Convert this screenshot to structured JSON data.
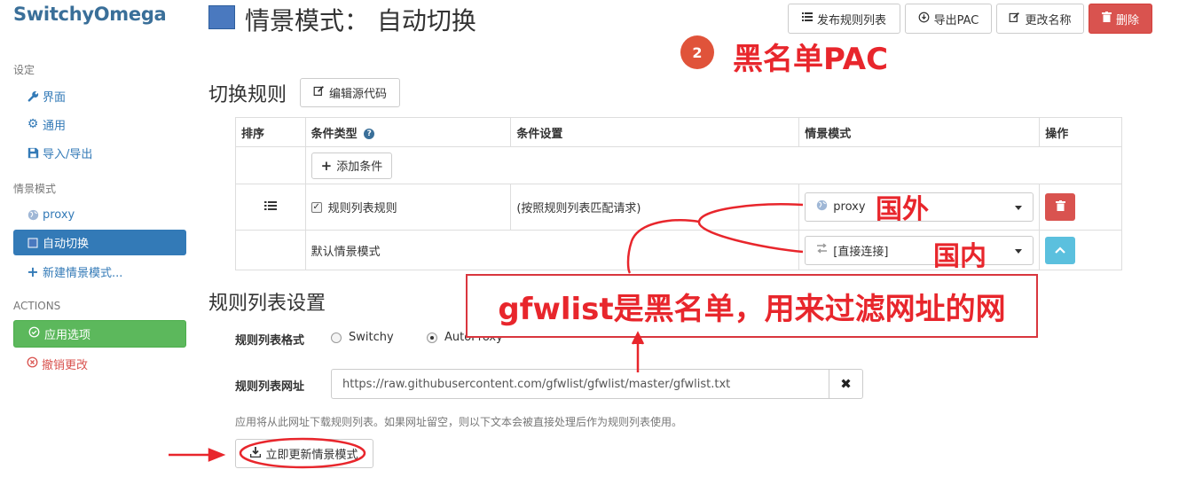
{
  "sidebar": {
    "brand": "SwitchyOmega",
    "settings_heading": "设定",
    "settings_items": [
      {
        "label": "界面",
        "icon": "wrench-icon"
      },
      {
        "label": "通用",
        "icon": "gear-icon"
      },
      {
        "label": "导入/导出",
        "icon": "floppy-icon"
      }
    ],
    "profiles_heading": "情景模式",
    "profiles": [
      {
        "label": "proxy",
        "icon": "globe-icon"
      },
      {
        "label": "自动切换",
        "icon": "auto-switch-icon",
        "active": true
      }
    ],
    "new_profile_label": "新建情景模式...",
    "actions_heading": "ACTIONS",
    "apply_label": "应用选项",
    "discard_label": "撤销更改"
  },
  "header": {
    "title": "情景模式： 自动切换",
    "buttons": {
      "publish": "发布规则列表",
      "export_pac": "导出PAC",
      "rename": "更改名称",
      "delete": "删除"
    }
  },
  "switch_rules": {
    "title": "切换规则",
    "edit_source_label": "编辑源代码",
    "columns": [
      "排序",
      "条件类型",
      "条件设置",
      "情景模式",
      "操作"
    ],
    "add_condition_label": "添加条件",
    "rule": {
      "condition_type": "规则列表规则",
      "checked": true,
      "condition_setting": "(按照规则列表匹配请求)",
      "profile": "proxy"
    },
    "default": {
      "label": "默认情景模式",
      "profile": "[直接连接]"
    }
  },
  "rule_list": {
    "title": "规则列表设置",
    "format_label": "规则列表格式",
    "format_options": [
      "Switchy",
      "AutoProxy"
    ],
    "format_selected": "AutoProxy",
    "url_label": "规则列表网址",
    "url_value": "https://raw.githubusercontent.com/gfwlist/gfwlist/master/gfwlist.txt",
    "help_text": "应用将从此网址下载规则列表。如果网址留空，则以下文本会被直接处理后作为规则列表使用。",
    "update_label": "立即更新情景模式"
  },
  "annotations": {
    "step_number": "2",
    "step_title": "黑名单PAC",
    "abroad": "国外",
    "domestic": "国内",
    "note": "gfwlist是黑名单，用来过滤网址的网",
    "color": "#e8262c"
  },
  "colors": {
    "brand": "#3a6f99",
    "primary": "#337ab7",
    "success": "#5cb85c",
    "danger": "#d9534f",
    "info": "#5bc0de"
  }
}
